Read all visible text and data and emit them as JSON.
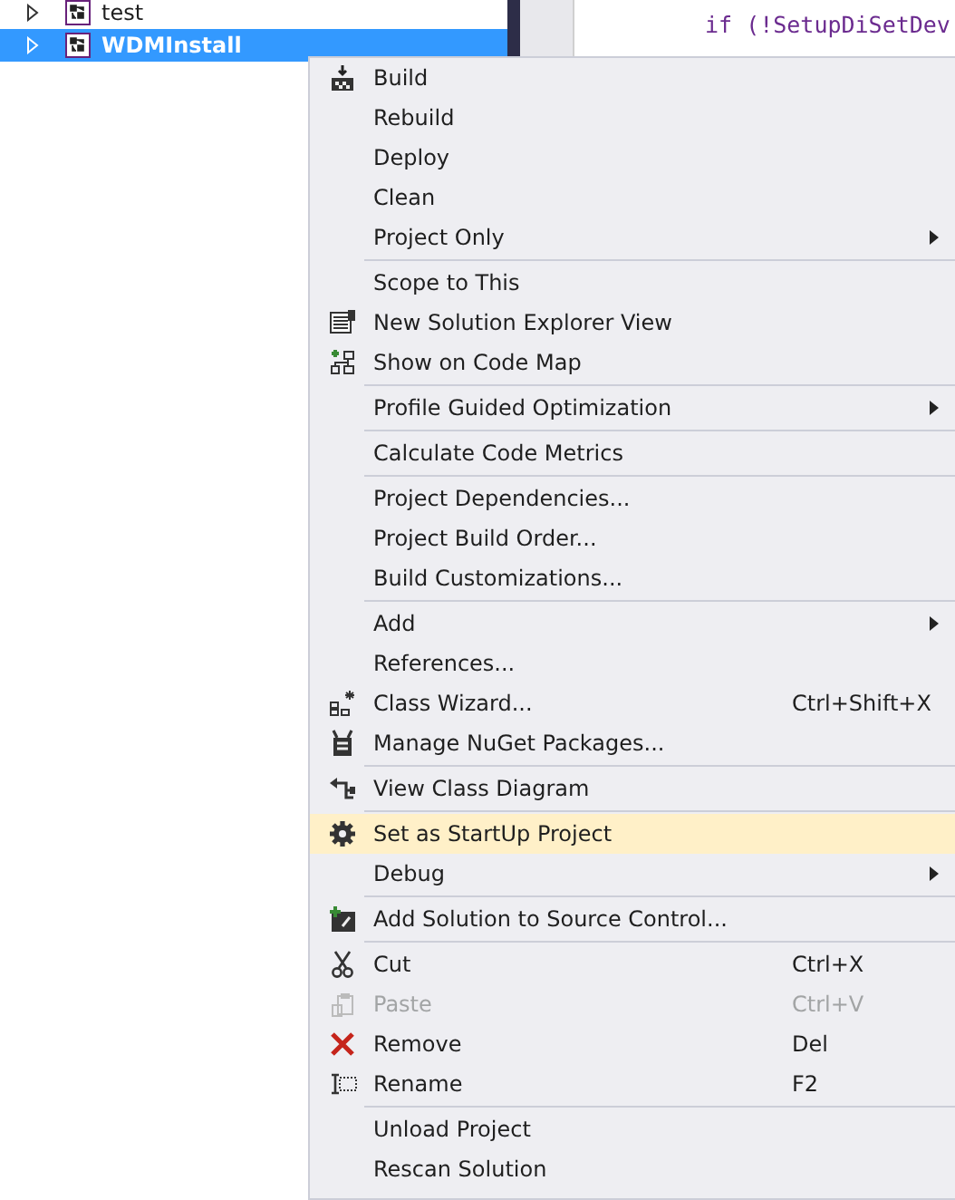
{
  "solution_tree": {
    "items": [
      {
        "label": "test",
        "expanded": false,
        "selected": false
      },
      {
        "label": "WDMInstall",
        "expanded": false,
        "selected": true
      }
    ]
  },
  "code_editor": {
    "lines": [
      "if (!SetupDiSetDev"
    ]
  },
  "context_menu": {
    "groups": [
      {
        "items": [
          {
            "label": "Build",
            "submenu": false,
            "disabled": false,
            "selected": false
          },
          {
            "label": "Rebuild",
            "submenu": false,
            "disabled": false,
            "selected": false
          },
          {
            "label": "Deploy",
            "submenu": false,
            "disabled": false,
            "selected": false
          },
          {
            "label": "Clean",
            "submenu": false,
            "disabled": false,
            "selected": false
          },
          {
            "label": "Project Only",
            "submenu": true,
            "disabled": false,
            "selected": false
          }
        ]
      },
      {
        "items": [
          {
            "label": "Scope to This",
            "submenu": false,
            "disabled": false,
            "selected": false
          },
          {
            "label": "New Solution Explorer View",
            "submenu": false,
            "disabled": false,
            "selected": false
          },
          {
            "label": "Show on Code Map",
            "submenu": false,
            "disabled": false,
            "selected": false
          }
        ]
      },
      {
        "items": [
          {
            "label": "Profile Guided Optimization",
            "submenu": true,
            "disabled": false,
            "selected": false
          }
        ]
      },
      {
        "items": [
          {
            "label": "Calculate Code Metrics",
            "submenu": false,
            "disabled": false,
            "selected": false
          }
        ]
      },
      {
        "items": [
          {
            "label": "Project Dependencies...",
            "submenu": false,
            "disabled": false,
            "selected": false
          },
          {
            "label": "Project Build Order...",
            "submenu": false,
            "disabled": false,
            "selected": false
          },
          {
            "label": "Build Customizations...",
            "submenu": false,
            "disabled": false,
            "selected": false
          }
        ]
      },
      {
        "items": [
          {
            "label": "Add",
            "submenu": true,
            "disabled": false,
            "selected": false
          },
          {
            "label": "References...",
            "submenu": false,
            "disabled": false,
            "selected": false
          },
          {
            "label": "Class Wizard...",
            "shortcut": "Ctrl+Shift+X",
            "submenu": false,
            "disabled": false,
            "selected": false
          },
          {
            "label": "Manage NuGet Packages...",
            "submenu": false,
            "disabled": false,
            "selected": false
          }
        ]
      },
      {
        "items": [
          {
            "label": "View Class Diagram",
            "submenu": false,
            "disabled": false,
            "selected": false
          }
        ]
      },
      {
        "items": [
          {
            "label": "Set as StartUp Project",
            "submenu": false,
            "disabled": false,
            "selected": true
          },
          {
            "label": "Debug",
            "submenu": true,
            "disabled": false,
            "selected": false
          }
        ]
      },
      {
        "items": [
          {
            "label": "Add Solution to Source Control...",
            "submenu": false,
            "disabled": false,
            "selected": false
          }
        ]
      },
      {
        "items": [
          {
            "label": "Cut",
            "shortcut": "Ctrl+X",
            "submenu": false,
            "disabled": false,
            "selected": false
          },
          {
            "label": "Paste",
            "shortcut": "Ctrl+V",
            "submenu": false,
            "disabled": true,
            "selected": false
          },
          {
            "label": "Remove",
            "shortcut": "Del",
            "submenu": false,
            "disabled": false,
            "selected": false
          },
          {
            "label": "Rename",
            "shortcut": "F2",
            "submenu": false,
            "disabled": false,
            "selected": false
          }
        ]
      },
      {
        "items": [
          {
            "label": "Unload Project",
            "submenu": false,
            "disabled": false,
            "selected": false
          },
          {
            "label": "Rescan Solution",
            "submenu": false,
            "disabled": false,
            "selected": false
          }
        ]
      }
    ]
  }
}
